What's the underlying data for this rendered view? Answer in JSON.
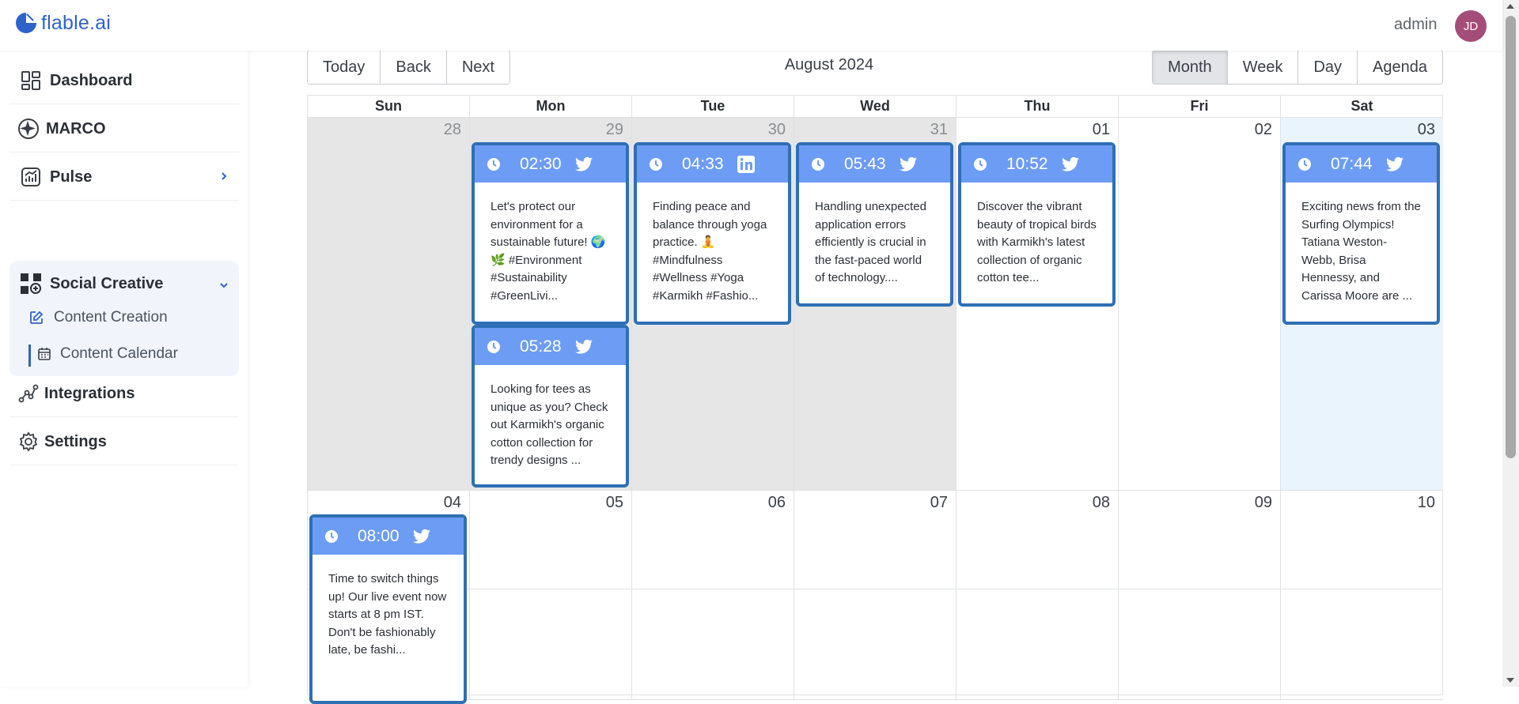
{
  "app": {
    "logo_text": "flable.ai",
    "user_name": "admin",
    "user_initials": "JD"
  },
  "colors": {
    "brand": "#2f63c9",
    "event_header": "#6d9cf5",
    "event_border": "#2f6fb5",
    "avatar": "#a44d78",
    "today_bg": "#eaf4fd",
    "off_range_bg": "#e6e6e6"
  },
  "sidebar": {
    "items": [
      {
        "label": "Dashboard",
        "icon": "dashboard-icon"
      },
      {
        "label": "MARCO",
        "icon": "sparkle-icon"
      },
      {
        "label": "Pulse",
        "icon": "chart-icon"
      },
      {
        "label": "Social Creative",
        "icon": "social-creative-icon",
        "subitems": [
          {
            "label": "Content Creation",
            "icon": "edit-icon"
          },
          {
            "label": "Content Calendar",
            "icon": "calendar-icon"
          }
        ]
      },
      {
        "label": "Integrations",
        "icon": "integrations-icon"
      },
      {
        "label": "Settings",
        "icon": "gear-icon"
      }
    ]
  },
  "toolbar": {
    "nav_buttons": [
      "Today",
      "Back",
      "Next"
    ],
    "title": "August 2024",
    "views": [
      "Month",
      "Week",
      "Day",
      "Agenda"
    ],
    "active_view": "Month"
  },
  "calendar": {
    "weekdays": [
      "Sun",
      "Mon",
      "Tue",
      "Wed",
      "Thu",
      "Fri",
      "Sat"
    ],
    "weeks": [
      [
        "28",
        "29",
        "30",
        "31",
        "01",
        "02",
        "03"
      ],
      [
        "04",
        "05",
        "06",
        "07",
        "08",
        "09",
        "10"
      ],
      [
        "",
        "",
        "",
        "",
        "",
        "",
        ""
      ]
    ],
    "events": [
      {
        "time": "02:30",
        "network": "twitter",
        "text": "Let's protect our environment for a sustainable future! 🌍 🌿 #Environment #Sustainability #GreenLivi..."
      },
      {
        "time": "05:28",
        "network": "twitter",
        "text": "Looking for tees as unique as you? Check out Karmikh's organic cotton collection for trendy designs ..."
      },
      {
        "time": "04:33",
        "network": "linkedin",
        "text": "Finding peace and balance through yoga practice. 🧘 #Mindfulness #Wellness #Yoga #Karmikh #Fashio..."
      },
      {
        "time": "05:43",
        "network": "twitter",
        "text": "Handling unexpected application errors efficiently is crucial in the fast-paced world of technology...."
      },
      {
        "time": "10:52",
        "network": "twitter",
        "text": "Discover the vibrant beauty of tropical birds with Karmikh's latest collection of organic cotton tee..."
      },
      {
        "time": "07:44",
        "network": "twitter",
        "text": "Exciting news from the Surfing Olympics! Tatiana Weston-Webb, Brisa Hennessy, and Carissa Moore are ..."
      },
      {
        "time": "08:00",
        "network": "twitter",
        "text": "Time to switch things up! Our live event now starts at 8 pm IST. Don't be fashionably late, be fashi..."
      }
    ]
  }
}
